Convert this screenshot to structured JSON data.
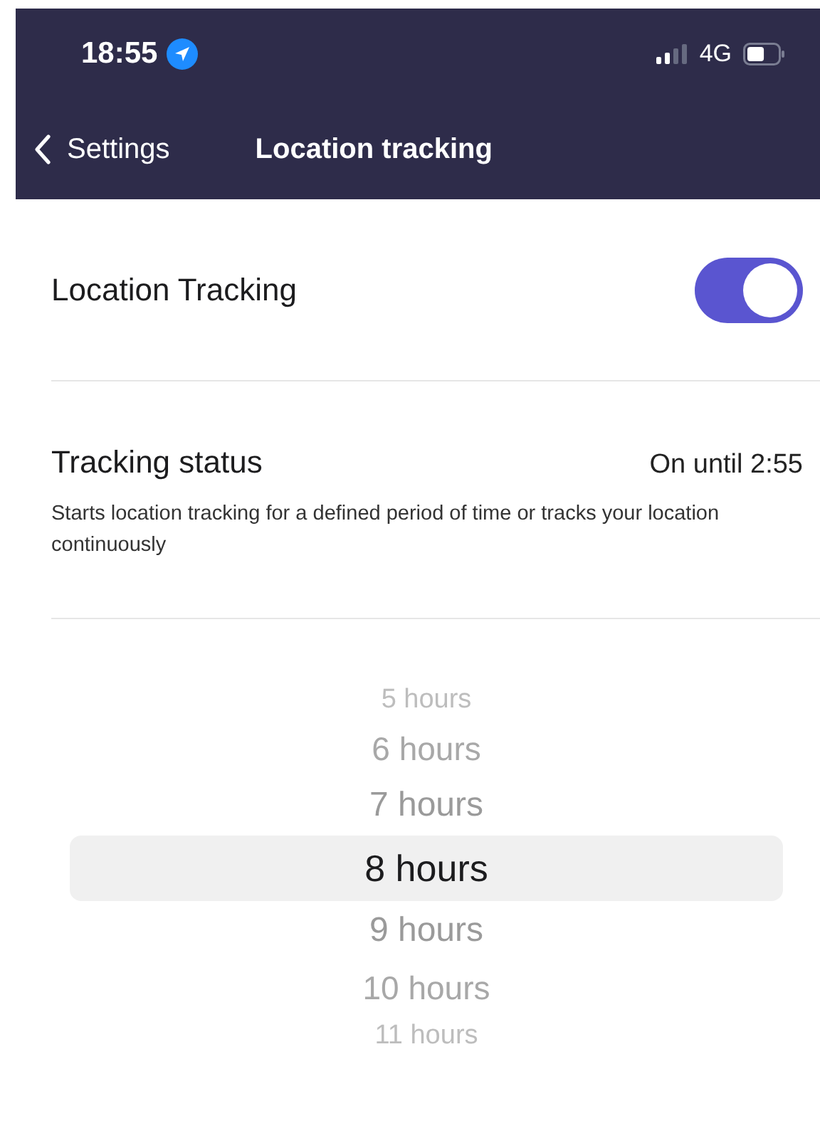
{
  "status_bar": {
    "time": "18:55",
    "location_active": true,
    "network": "4G",
    "battery": {
      "level": 0.55
    }
  },
  "nav": {
    "back": "Settings",
    "title": "Location tracking"
  },
  "toggle_row": {
    "label": "Location Tracking",
    "on": true
  },
  "status_row": {
    "label": "Tracking status",
    "value": "On until 2:55",
    "description": "Starts location tracking for a defined period of time or tracks your location continuously"
  },
  "picker": {
    "items": [
      {
        "label": "5 hours",
        "selected": false
      },
      {
        "label": "6 hours",
        "selected": false
      },
      {
        "label": "7 hours",
        "selected": false
      },
      {
        "label": "8 hours",
        "selected": true
      },
      {
        "label": "9 hours",
        "selected": false
      },
      {
        "label": "10 hours",
        "selected": false
      },
      {
        "label": "11 hours",
        "selected": false
      }
    ]
  }
}
